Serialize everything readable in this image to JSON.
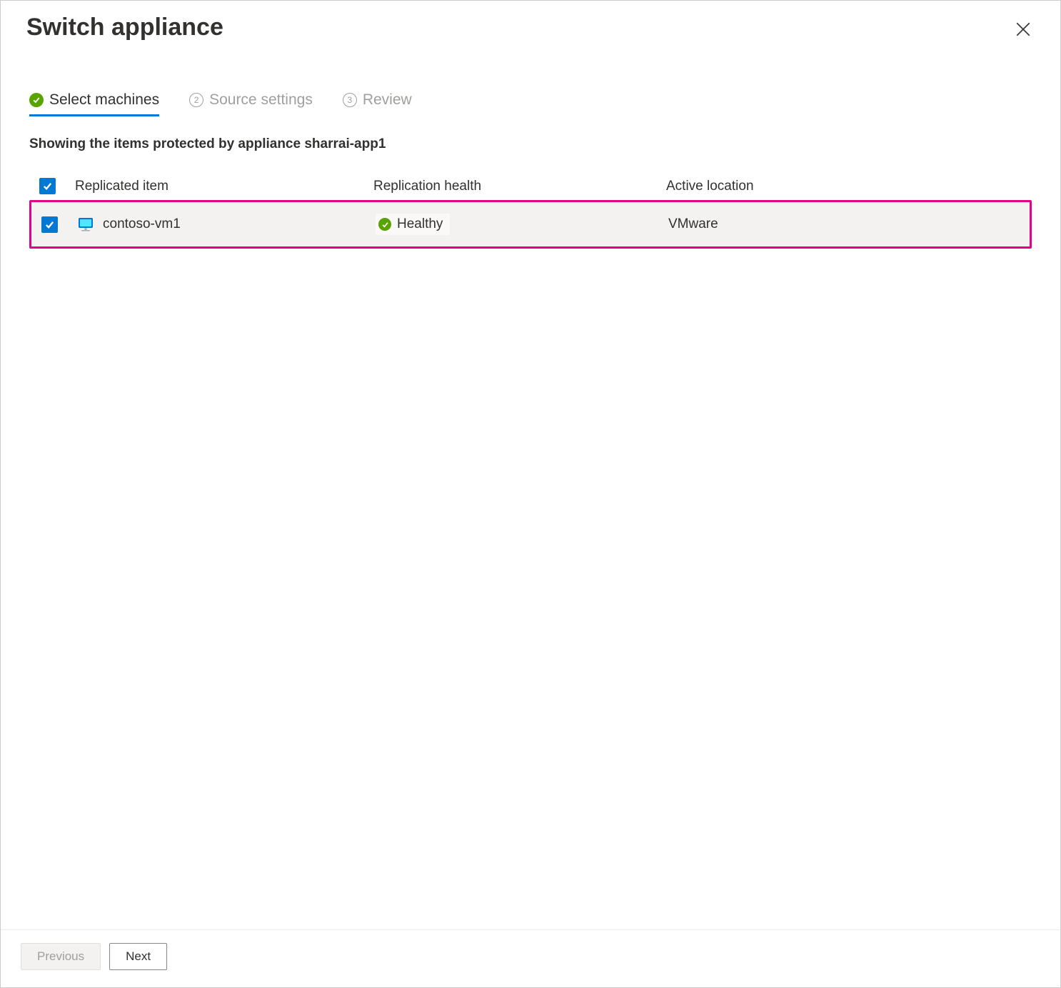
{
  "header": {
    "title": "Switch appliance"
  },
  "steps": [
    {
      "label": "Select machines",
      "status": "complete",
      "number": null
    },
    {
      "label": "Source settings",
      "status": "pending",
      "number": "2"
    },
    {
      "label": "Review",
      "status": "pending",
      "number": "3"
    }
  ],
  "subtitle": "Showing the items protected by appliance sharrai-app1",
  "table": {
    "columns": {
      "item": "Replicated item",
      "health": "Replication health",
      "location": "Active location"
    },
    "rows": [
      {
        "name": "contoso-vm1",
        "health_label": "Healthy",
        "location": "VMware",
        "checked": true
      }
    ]
  },
  "footer": {
    "previous": "Previous",
    "next": "Next"
  }
}
